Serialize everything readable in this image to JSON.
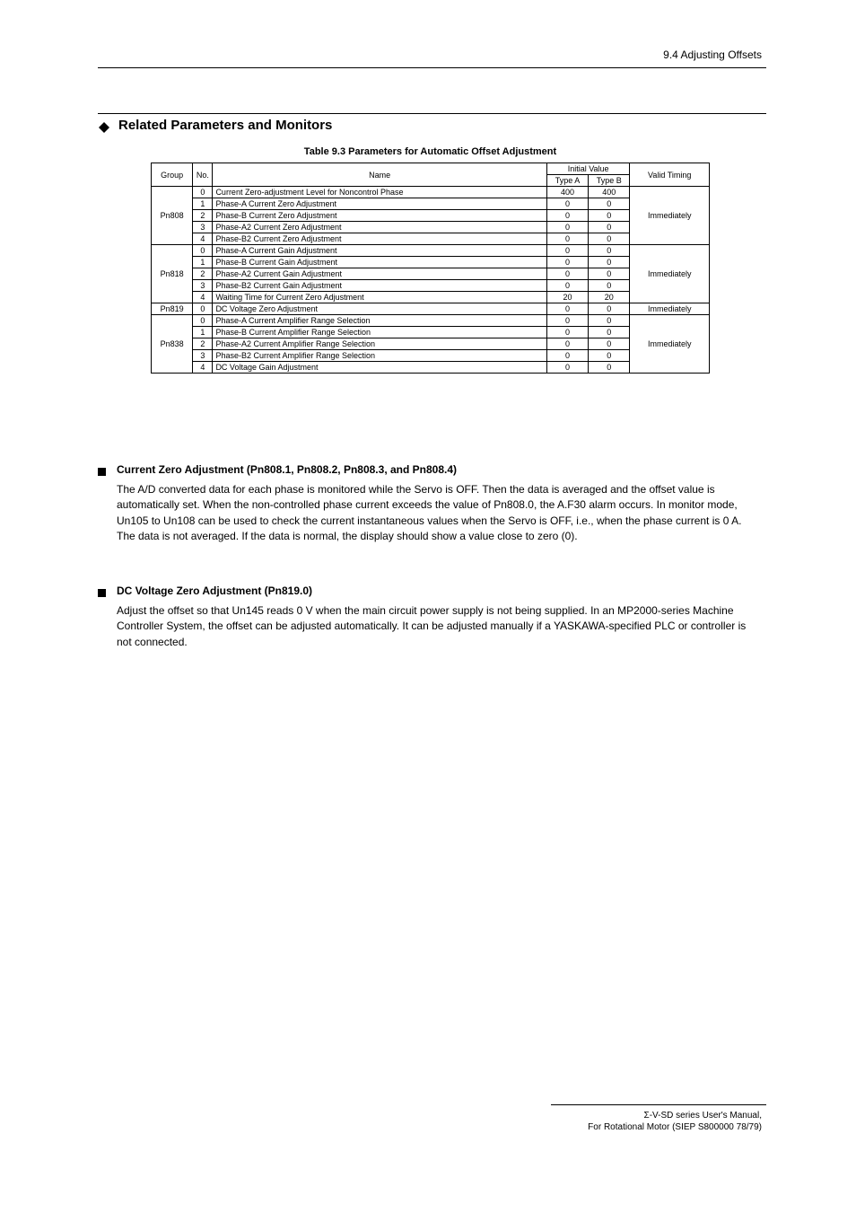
{
  "header_right": "9.4 Adjusting Offsets",
  "section_heading": "Related Parameters and Monitors",
  "table_title": "Table 9.3  Parameters for Automatic Offset Adjustment",
  "table_headers": {
    "group": "Group",
    "no": "No.",
    "fn": "Name",
    "init": "Initial Value",
    "init_a": "Type A",
    "init_b": "Type B",
    "valid": "Valid Timing"
  },
  "groups": [
    {
      "group": "Pn808",
      "valid": "Immediately",
      "rows": [
        {
          "no": "0",
          "fn": "Current Zero-adjustment Level for Noncontrol Phase",
          "a": "400",
          "b": "400"
        },
        {
          "no": "1",
          "fn": "Phase-A Current Zero Adjustment",
          "a": "0",
          "b": "0"
        },
        {
          "no": "2",
          "fn": "Phase-B Current Zero Adjustment",
          "a": "0",
          "b": "0"
        },
        {
          "no": "3",
          "fn": "Phase-A2 Current Zero Adjustment",
          "a": "0",
          "b": "0"
        },
        {
          "no": "4",
          "fn": "Phase-B2 Current Zero Adjustment",
          "a": "0",
          "b": "0"
        }
      ]
    },
    {
      "group": "Pn818",
      "valid": "Immediately",
      "rows": [
        {
          "no": "0",
          "fn": "Phase-A Current Gain Adjustment",
          "a": "0",
          "b": "0"
        },
        {
          "no": "1",
          "fn": "Phase-B Current Gain Adjustment",
          "a": "0",
          "b": "0"
        },
        {
          "no": "2",
          "fn": "Phase-A2 Current Gain Adjustment",
          "a": "0",
          "b": "0"
        },
        {
          "no": "3",
          "fn": "Phase-B2 Current Gain Adjustment",
          "a": "0",
          "b": "0"
        },
        {
          "no": "4",
          "fn": "Waiting Time for Current Zero Adjustment",
          "a": "20",
          "b": "20"
        }
      ]
    },
    {
      "group": "Pn819",
      "valid": "Immediately",
      "rows": [
        {
          "no": "0",
          "fn": "DC Voltage Zero Adjustment",
          "a": "0",
          "b": "0"
        }
      ]
    },
    {
      "group": "Pn838",
      "valid": "Immediately",
      "rows": [
        {
          "no": "0",
          "fn": "Phase-A Current Amplifier Range Selection",
          "a": "0",
          "b": "0"
        },
        {
          "no": "1",
          "fn": "Phase-B Current Amplifier Range Selection",
          "a": "0",
          "b": "0"
        },
        {
          "no": "2",
          "fn": "Phase-A2 Current Amplifier Range Selection",
          "a": "0",
          "b": "0"
        },
        {
          "no": "3",
          "fn": "Phase-B2 Current Amplifier Range Selection",
          "a": "0",
          "b": "0"
        },
        {
          "no": "4",
          "fn": "DC Voltage Gain Adjustment",
          "a": "0",
          "b": "0"
        }
      ]
    }
  ],
  "sub1": {
    "title": "Current Zero Adjustment (Pn808.1, Pn808.2, Pn808.3, and Pn808.4)",
    "body": "The A/D converted data for each phase is monitored while the Servo is OFF. Then the data is averaged and the offset value is automatically set. When the non-controlled phase current exceeds the value of Pn808.0, the A.F30 alarm occurs. In monitor mode, Un105 to Un108 can be used to check the current instantaneous values when the Servo is OFF, i.e., when the phase current is 0 A. The data is not averaged. If the data is normal, the display should show a value close to zero (0)."
  },
  "sub2": {
    "title": "DC Voltage Zero Adjustment (Pn819.0)",
    "body": "Adjust the offset so that Un145 reads 0 V when the main circuit power supply is not being supplied. In an MP2000-series Machine Controller System, the offset can be adjusted automatically. It can be adjusted manually if a YASKAWA-specified PLC or controller is not connected."
  },
  "footer": {
    "line1": "Σ-V-SD series User's Manual,",
    "line2": "For Rotational Motor (SIEP S800000 78/79)"
  }
}
